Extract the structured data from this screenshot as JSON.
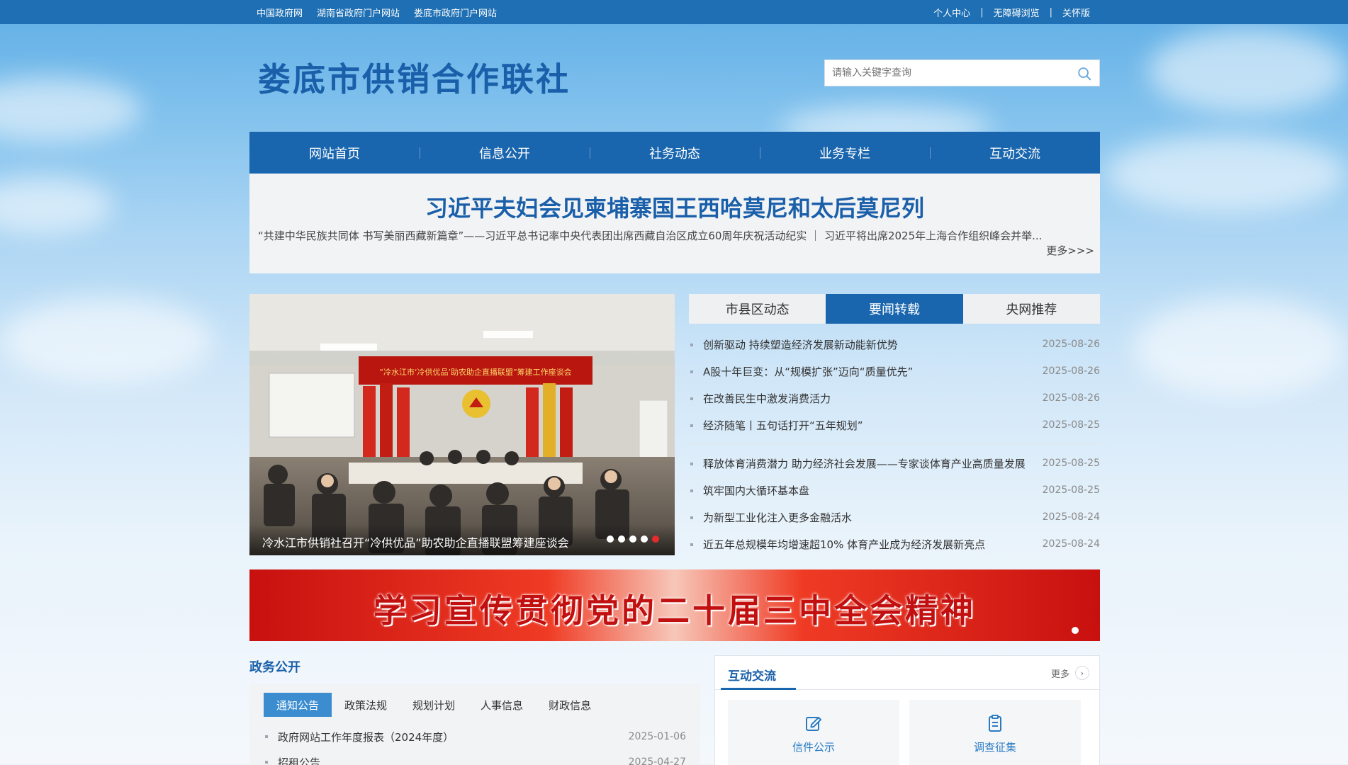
{
  "topbar": {
    "left_links": [
      "中国政府网",
      "湖南省政府门户网站",
      "娄底市政府门户网站"
    ],
    "right_links": [
      "个人中心",
      "无障碍浏览",
      "关怀版"
    ],
    "separator": "|"
  },
  "site": {
    "title": "娄底市供销合作联社"
  },
  "search": {
    "placeholder": "请输入关键字查询"
  },
  "nav": {
    "items": [
      "网站首页",
      "信息公开",
      "社务动态",
      "业务专栏",
      "互动交流"
    ]
  },
  "headline": {
    "title": "习近平夫妇会见柬埔寨国王西哈莫尼和太后莫尼列",
    "subtitle": "“共建中华民族共同体 书写美丽西藏新篇章”——习近平总书记率中央代表团出席西藏自治区成立60周年庆祝活动纪实 ｜ 习近平将出席2025年上海合作组织峰会并举...",
    "more": "更多>>>"
  },
  "slider": {
    "caption": "冷水江市供销社召开“冷供优品”助农助企直播联盟筹建座谈会",
    "dots": 5,
    "active_dot": 5,
    "banner_text": "“冷水江市‘冷供优品’助农助企直播联盟”筹建工作座谈会"
  },
  "news": {
    "tabs": [
      "市县区动态",
      "要闻转载",
      "央网推荐"
    ],
    "active_tab": "要闻转载",
    "group1": [
      {
        "title": "创新驱动 持续塑造经济发展新动能新优势",
        "date": "2025-08-26"
      },
      {
        "title": "A股十年巨变：从“规模扩张”迈向“质量优先”",
        "date": "2025-08-26"
      },
      {
        "title": "在改善民生中激发消费活力",
        "date": "2025-08-26"
      },
      {
        "title": "经济随笔丨五句话打开“五年规划”",
        "date": "2025-08-25"
      }
    ],
    "group2": [
      {
        "title": "释放体育消费潜力 助力经济社会发展——专家谈体育产业高质量发展",
        "date": "2025-08-25"
      },
      {
        "title": "筑牢国内大循环基本盘",
        "date": "2025-08-25"
      },
      {
        "title": "为新型工业化注入更多金融活水",
        "date": "2025-08-24"
      },
      {
        "title": "近五年总规模年均增速超10% 体育产业成为经济发展新亮点",
        "date": "2025-08-24"
      }
    ]
  },
  "banner": {
    "text": "学习宣传贯彻党的二十届三中全会精神"
  },
  "gov": {
    "heading": "政务公开",
    "tabs": [
      "通知公告",
      "政策法规",
      "规划计划",
      "人事信息",
      "财政信息"
    ],
    "active_tab": "通知公告",
    "items": [
      {
        "title": "政府网站工作年度报表（2024年度）",
        "date": "2025-01-06"
      },
      {
        "title": "招租公告",
        "date": "2025-04-27"
      }
    ]
  },
  "interaction": {
    "heading": "互动交流",
    "more": "更多",
    "cards": [
      "信件公示",
      "调查征集"
    ]
  },
  "colors": {
    "primary": "#1a66ae",
    "title": "#1a5fa9",
    "topbar": "#1e6fb3",
    "active_dot": "#e52b2b"
  },
  "icons": [
    "search-icon",
    "edit-icon",
    "clipboard-icon",
    "chevron-right-icon"
  ]
}
